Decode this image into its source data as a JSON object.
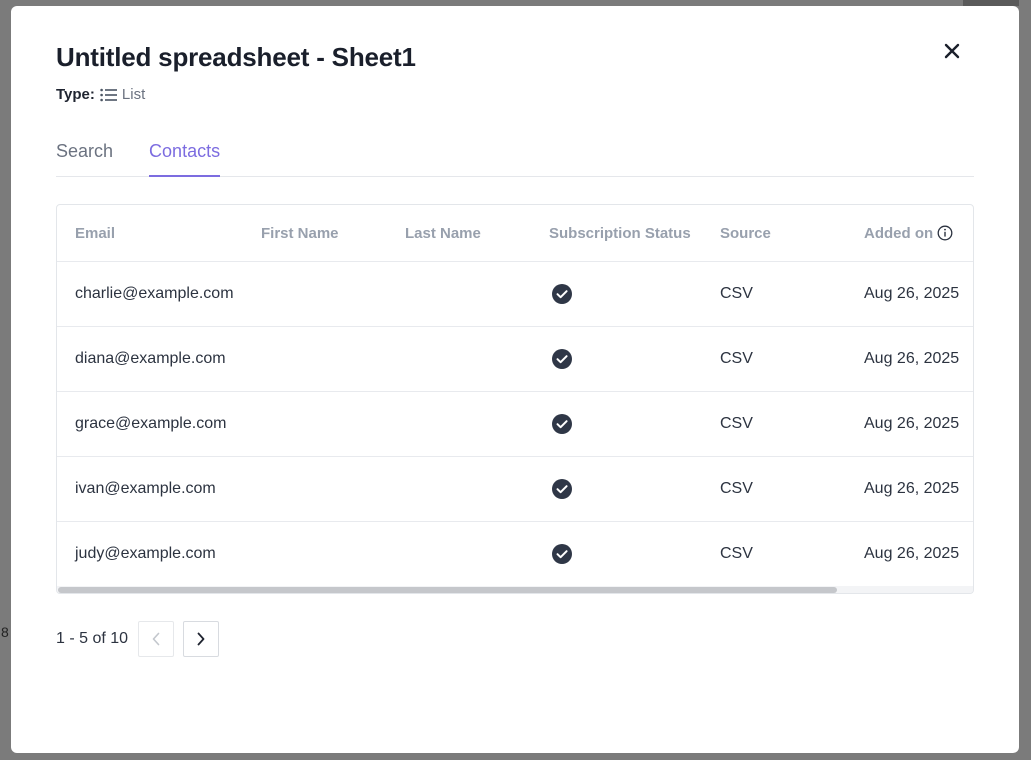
{
  "backdrop": {
    "partial_text": "8"
  },
  "modal": {
    "title": "Untitled spreadsheet - Sheet1",
    "type_label": "Type:",
    "type_value": "List",
    "type_icon": "list-icon",
    "close_icon": "close-icon"
  },
  "tabs": [
    {
      "label": "Search",
      "active": false
    },
    {
      "label": "Contacts",
      "active": true
    }
  ],
  "table": {
    "columns": [
      "Email",
      "First Name",
      "Last Name",
      "Subscription Status",
      "Source",
      "Added on"
    ],
    "rows": [
      {
        "email": "charlie@example.com",
        "first_name": "",
        "last_name": "",
        "status": "subscribed",
        "source": "CSV",
        "added_on": "Aug 26, 2025"
      },
      {
        "email": "diana@example.com",
        "first_name": "",
        "last_name": "",
        "status": "subscribed",
        "source": "CSV",
        "added_on": "Aug 26, 2025"
      },
      {
        "email": "grace@example.com",
        "first_name": "",
        "last_name": "",
        "status": "subscribed",
        "source": "CSV",
        "added_on": "Aug 26, 2025"
      },
      {
        "email": "ivan@example.com",
        "first_name": "",
        "last_name": "",
        "status": "subscribed",
        "source": "CSV",
        "added_on": "Aug 26, 2025"
      },
      {
        "email": "judy@example.com",
        "first_name": "",
        "last_name": "",
        "status": "subscribed",
        "source": "CSV",
        "added_on": "Aug 26, 2025"
      }
    ]
  },
  "pagination": {
    "summary": "1 - 5 of 10",
    "prev_icon": "chevron-left-icon",
    "next_icon": "chevron-right-icon"
  },
  "colors": {
    "accent": "#7c6ce0",
    "status_icon": "#2f3747"
  }
}
